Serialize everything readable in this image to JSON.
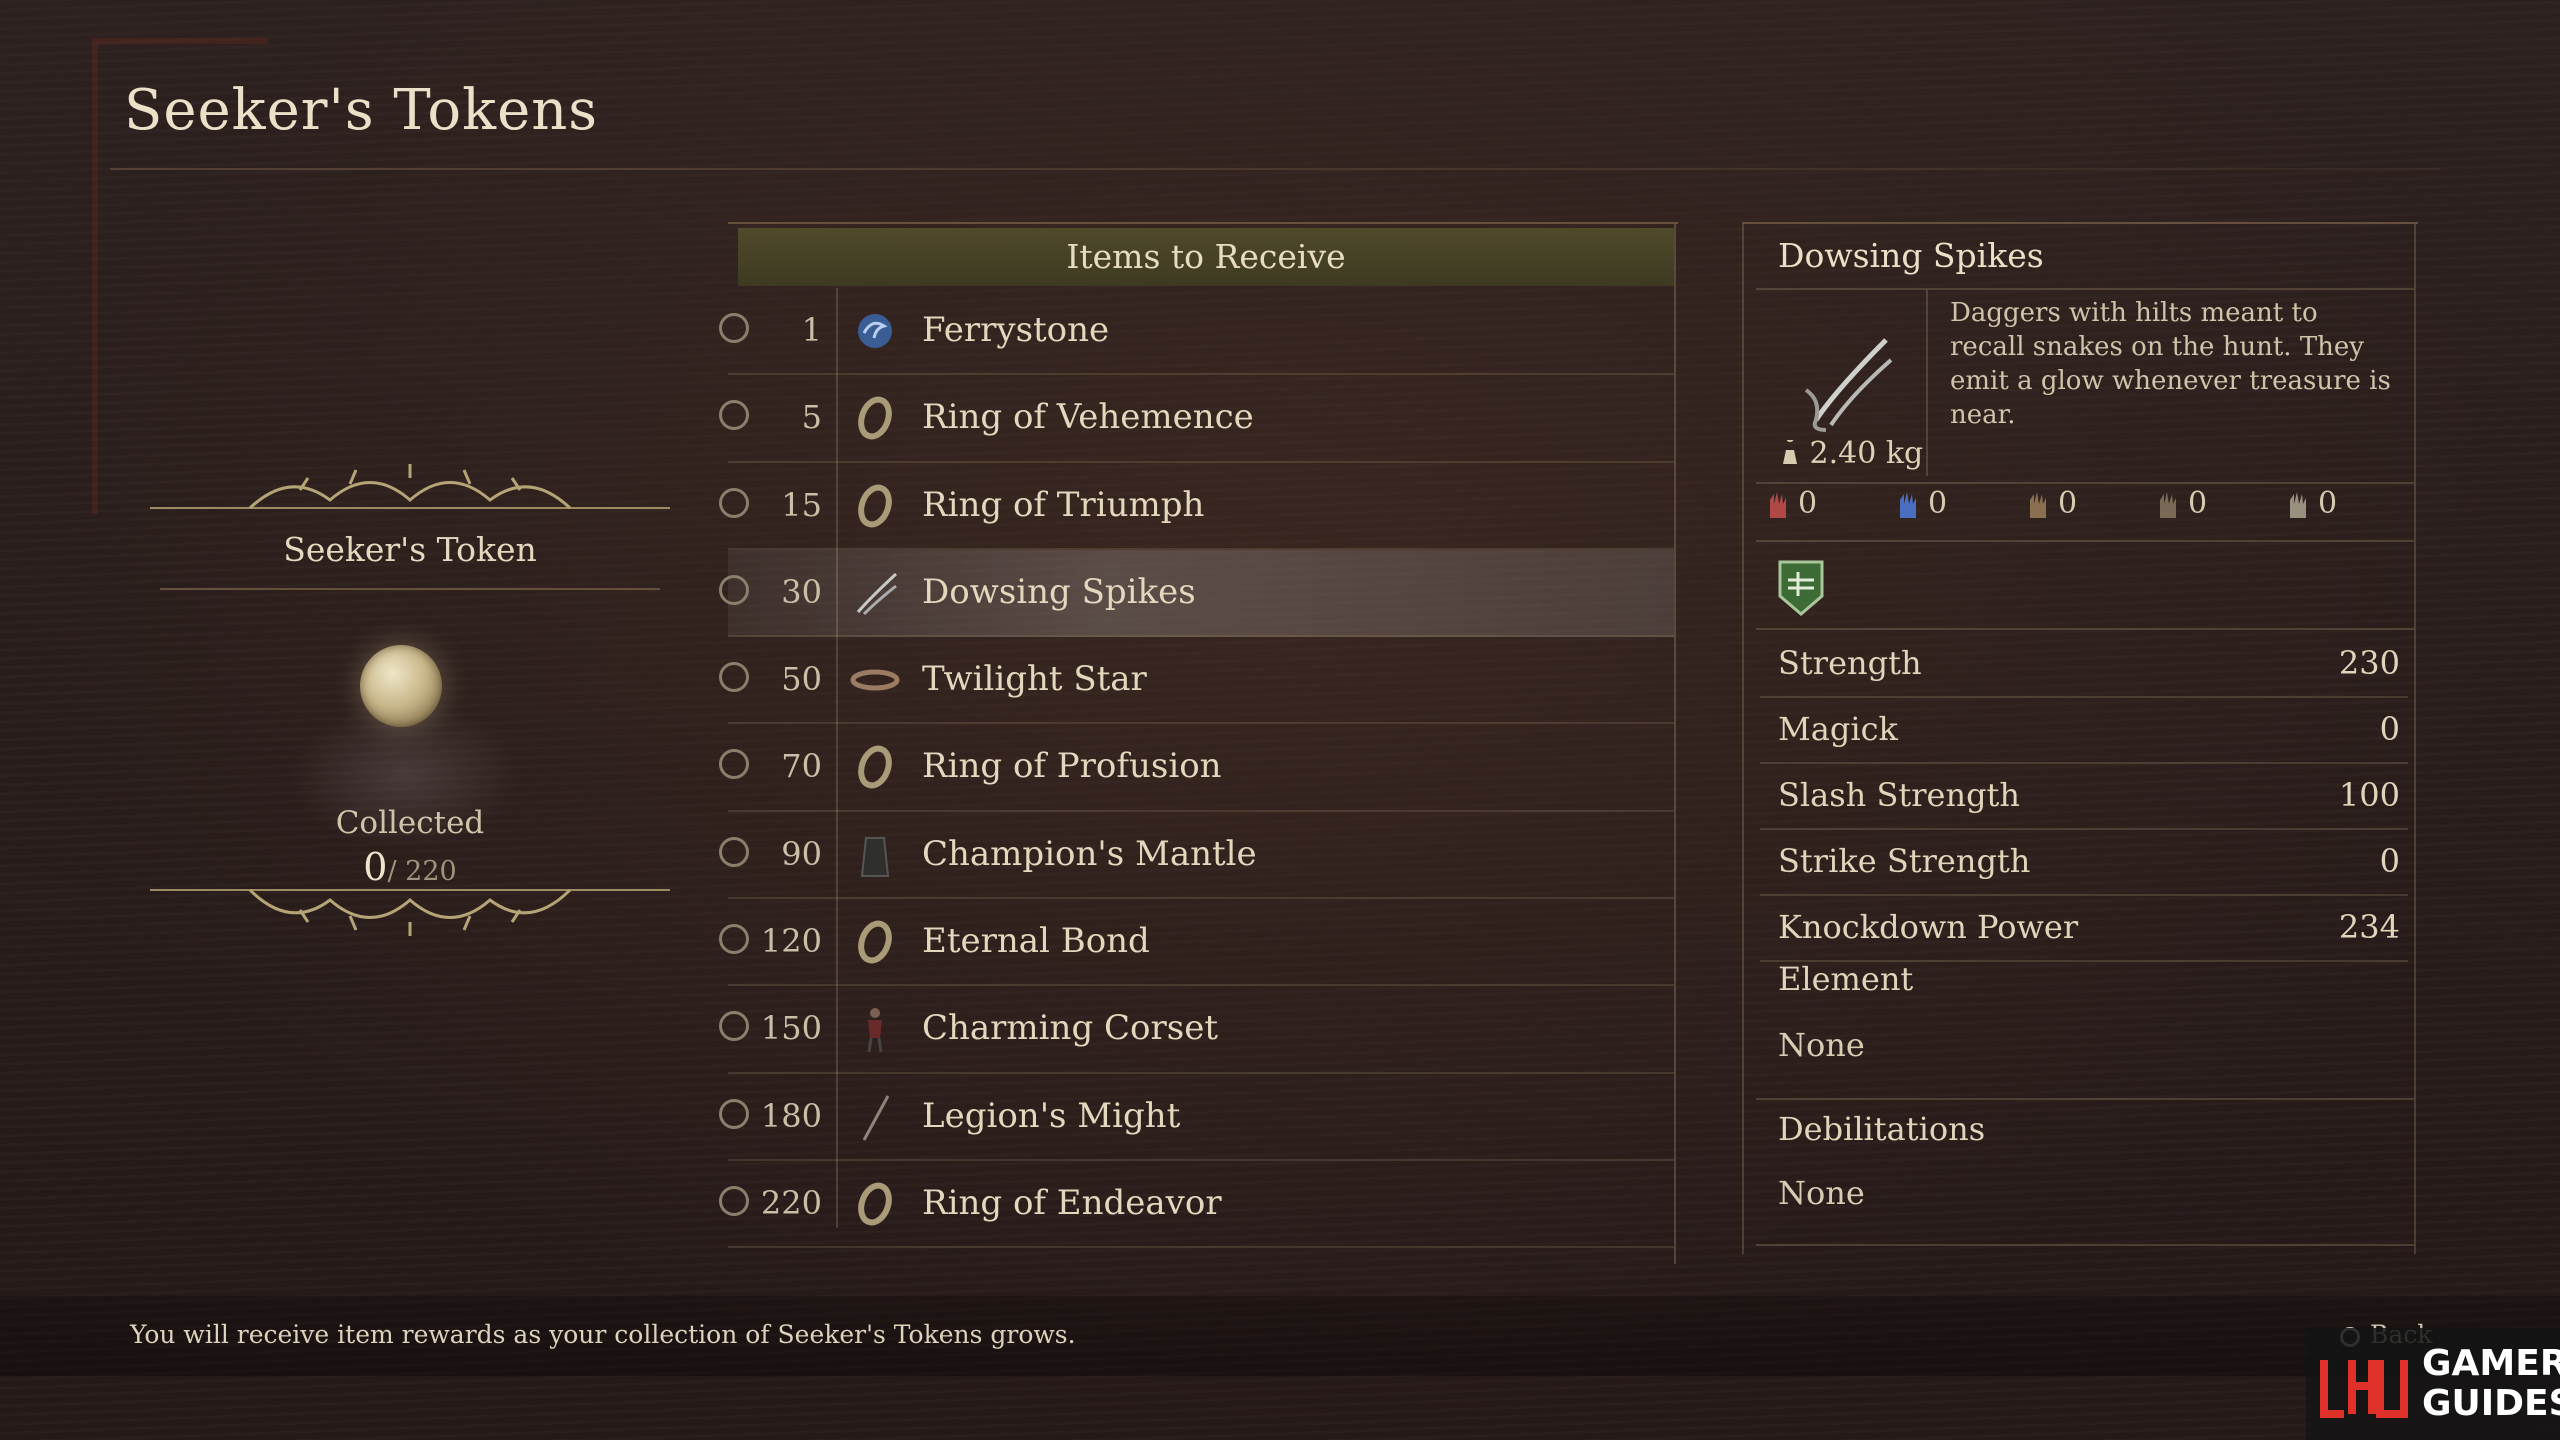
{
  "page": {
    "title": "Seeker's Tokens"
  },
  "token": {
    "name": "Seeker's Token",
    "collected_label": "Collected",
    "collected_count": "0",
    "collected_max": "/ 220"
  },
  "items_panel": {
    "header": "Items to Receive",
    "items": [
      {
        "threshold": "1",
        "name": "Ferrystone",
        "icon": "ferrystone-icon",
        "selected": false
      },
      {
        "threshold": "5",
        "name": "Ring of Vehemence",
        "icon": "ring-icon",
        "selected": false
      },
      {
        "threshold": "15",
        "name": "Ring of Triumph",
        "icon": "ring-icon",
        "selected": false
      },
      {
        "threshold": "30",
        "name": "Dowsing Spikes",
        "icon": "dagger-icon",
        "selected": true
      },
      {
        "threshold": "50",
        "name": "Twilight Star",
        "icon": "circlet-icon",
        "selected": false
      },
      {
        "threshold": "70",
        "name": "Ring of Profusion",
        "icon": "ring-icon",
        "selected": false
      },
      {
        "threshold": "90",
        "name": "Champion's Mantle",
        "icon": "mantle-icon",
        "selected": false
      },
      {
        "threshold": "120",
        "name": "Eternal Bond",
        "icon": "ring-icon",
        "selected": false
      },
      {
        "threshold": "150",
        "name": "Charming Corset",
        "icon": "corset-icon",
        "selected": false
      },
      {
        "threshold": "180",
        "name": "Legion's Might",
        "icon": "staff-icon",
        "selected": false
      },
      {
        "threshold": "220",
        "name": "Ring of Endeavor",
        "icon": "ring-icon",
        "selected": false
      }
    ]
  },
  "detail": {
    "title": "Dowsing Spikes",
    "weight": "2.40 kg",
    "description": "Daggers with hilts meant to recall snakes on the hunt. They emit a glow whenever treasure is near.",
    "resistances": [
      {
        "icon": "red-hand-icon",
        "value": "0",
        "color": "#b04848"
      },
      {
        "icon": "blue-hand-icon",
        "value": "0",
        "color": "#4a6fc0"
      },
      {
        "icon": "brown-hand-icon",
        "value": "0",
        "color": "#8a7050"
      },
      {
        "icon": "dark-hand-icon",
        "value": "0",
        "color": "#7a6a55"
      },
      {
        "icon": "chest-icon",
        "value": "0",
        "color": "#9a9080"
      }
    ],
    "badge_icon": "dagger-class-badge-icon",
    "stats": [
      {
        "label": "Strength",
        "value": "230"
      },
      {
        "label": "Magick",
        "value": "0"
      },
      {
        "label": "Slash Strength",
        "value": "100"
      },
      {
        "label": "Strike Strength",
        "value": "0"
      },
      {
        "label": "Knockdown Power",
        "value": "234"
      }
    ],
    "element_label": "Element",
    "element_value": "None",
    "debilitations_label": "Debilitations",
    "debilitations_value": "None"
  },
  "footer": {
    "hint": "You will receive item rewards as your collection of Seeker's Tokens grows.",
    "back_label": "Back"
  },
  "watermark": {
    "line1": "GAMER",
    "line2": "GUIDES",
    "accent": "#e0302a"
  }
}
